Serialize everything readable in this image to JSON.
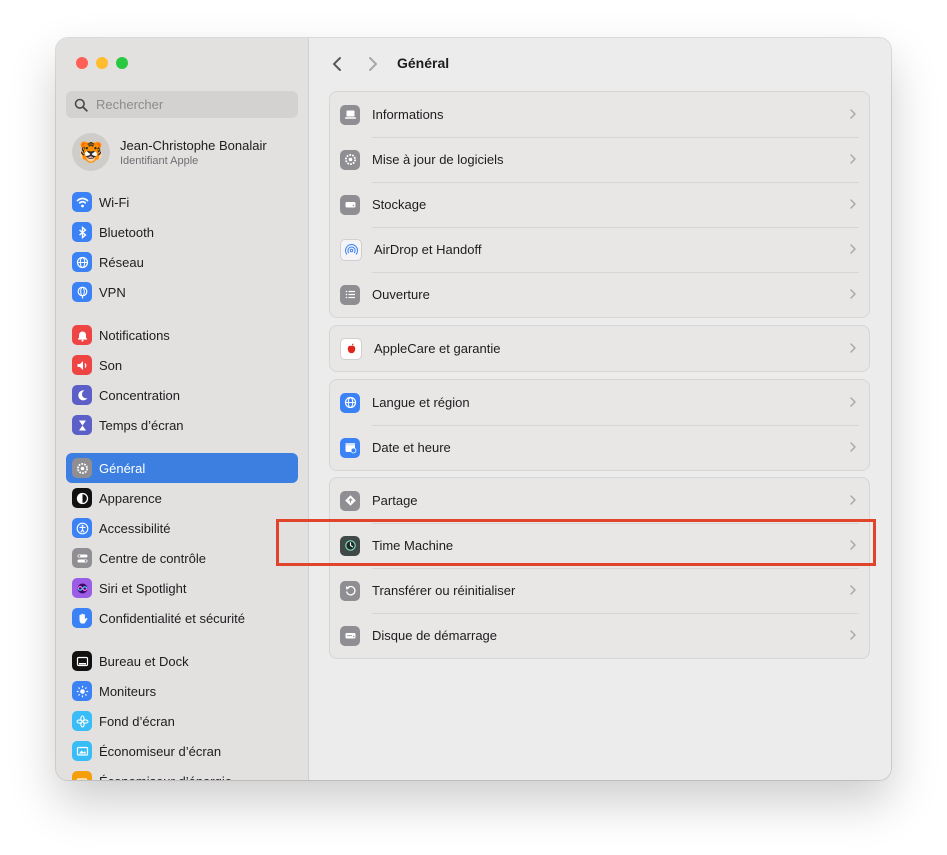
{
  "colors": {
    "accent": "#3c7fe0",
    "highlight_border": "#e0452b",
    "traffic_close": "#ff5f57",
    "traffic_min": "#febc2e",
    "traffic_max": "#28c840"
  },
  "search": {
    "placeholder": "Rechercher"
  },
  "user": {
    "name": "Jean-Christophe Bonalair",
    "subtitle": "Identifiant Apple",
    "avatar_icon": "tiger-avatar"
  },
  "sidebar": {
    "items": [
      {
        "label": "Wi-Fi",
        "icon": "wifi-icon",
        "color": "#3b82f6"
      },
      {
        "label": "Bluetooth",
        "icon": "bluetooth-icon",
        "color": "#3b82f6"
      },
      {
        "label": "Réseau",
        "icon": "globe-icon",
        "color": "#3b82f6"
      },
      {
        "label": "VPN",
        "icon": "vpn-globe-icon",
        "color": "#3b82f6"
      },
      {
        "label": "Notifications",
        "icon": "bell-icon",
        "color": "#ef4444"
      },
      {
        "label": "Son",
        "icon": "speaker-icon",
        "color": "#ef4444"
      },
      {
        "label": "Concentration",
        "icon": "moon-icon",
        "color": "#5b5fc7"
      },
      {
        "label": "Temps d’écran",
        "icon": "hourglass-icon",
        "color": "#5b5fc7"
      },
      {
        "label": "Général",
        "icon": "gear-icon",
        "color": "#8e8e93"
      },
      {
        "label": "Apparence",
        "icon": "appearance-icon",
        "color": "#111111"
      },
      {
        "label": "Accessibilité",
        "icon": "accessibility-icon",
        "color": "#3b82f6"
      },
      {
        "label": "Centre de contrôle",
        "icon": "control-center-icon",
        "color": "#8e8e93"
      },
      {
        "label": "Siri et Spotlight",
        "icon": "siri-icon",
        "color": "#9b5de5"
      },
      {
        "label": "Confidentialité et sécurité",
        "icon": "hand-icon",
        "color": "#3b82f6"
      },
      {
        "label": "Bureau et Dock",
        "icon": "dock-icon",
        "color": "#111111"
      },
      {
        "label": "Moniteurs",
        "icon": "sun-icon",
        "color": "#3b82f6"
      },
      {
        "label": "Fond d’écran",
        "icon": "flower-icon",
        "color": "#38bdf8"
      },
      {
        "label": "Économiseur d’écran",
        "icon": "screensaver-icon",
        "color": "#38bdf8"
      },
      {
        "label": "Économiseur d’énergie",
        "icon": "battery-icon",
        "color": "#f59e0b"
      }
    ]
  },
  "main": {
    "title": "Général",
    "groups": [
      {
        "rows": [
          {
            "label": "Informations",
            "icon": "laptop-icon"
          },
          {
            "label": "Mise à jour de logiciels",
            "icon": "update-gear-icon"
          },
          {
            "label": "Stockage",
            "icon": "drive-icon"
          },
          {
            "label": "AirDrop et Handoff",
            "icon": "airdrop-icon"
          },
          {
            "label": "Ouverture",
            "icon": "list-icon"
          }
        ]
      },
      {
        "rows": [
          {
            "label": "AppleCare et garantie",
            "icon": "apple-icon"
          }
        ]
      },
      {
        "rows": [
          {
            "label": "Langue et région",
            "icon": "globe-icon"
          },
          {
            "label": "Date et heure",
            "icon": "calendar-clock-icon"
          }
        ]
      },
      {
        "rows": [
          {
            "label": "Partage",
            "icon": "sharing-icon"
          },
          {
            "label": "Time Machine",
            "icon": "time-machine-icon"
          },
          {
            "label": "Transférer ou réinitialiser",
            "icon": "reset-icon"
          },
          {
            "label": "Disque de démarrage",
            "icon": "startup-disk-icon"
          }
        ]
      }
    ]
  }
}
